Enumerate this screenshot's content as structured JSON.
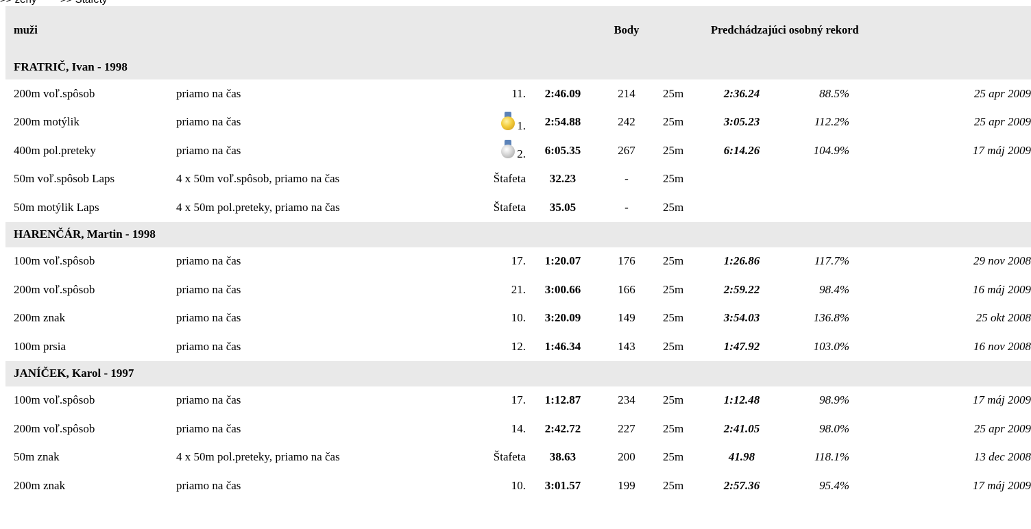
{
  "nav": {
    "link_women": ">> ženy",
    "link_relays": ">> Štafety"
  },
  "table": {
    "header": {
      "category": "muži",
      "points": "Body",
      "previous_pb": "Predchádzajúci osobný rekord"
    },
    "swimmers": [
      {
        "name": "FRATRIČ, Ivan - 1998",
        "results": [
          {
            "event": "200m voľ.spôsob",
            "heat": "priamo na čas",
            "place": "11.",
            "medal": "",
            "time": "2:46.09",
            "points": "214",
            "pool": "25m",
            "pb": "2:36.24",
            "pct": "88.5%",
            "date": "25 apr 2009"
          },
          {
            "event": "200m motýlik",
            "heat": "priamo na čas",
            "place": "1.",
            "medal": "gold-medal-icon",
            "time": "2:54.88",
            "points": "242",
            "pool": "25m",
            "pb": "3:05.23",
            "pct": "112.2%",
            "date": "25 apr 2009"
          },
          {
            "event": "400m pol.preteky",
            "heat": "priamo na čas",
            "place": "2.",
            "medal": "silver-medal-icon",
            "time": "6:05.35",
            "points": "267",
            "pool": "25m",
            "pb": "6:14.26",
            "pct": "104.9%",
            "date": "17 máj 2009"
          },
          {
            "event": "50m voľ.spôsob Laps",
            "heat": "4 x 50m voľ.spôsob, priamo na čas",
            "place": "Štafeta",
            "medal": "",
            "time": "32.23",
            "points": "-",
            "pool": "25m",
            "pb": "",
            "pct": "",
            "date": ""
          },
          {
            "event": "50m motýlik Laps",
            "heat": "4 x 50m pol.preteky, priamo na čas",
            "place": "Štafeta",
            "medal": "",
            "time": "35.05",
            "points": "-",
            "pool": "25m",
            "pb": "",
            "pct": "",
            "date": ""
          }
        ]
      },
      {
        "name": "HARENČÁR, Martin - 1998",
        "results": [
          {
            "event": "100m voľ.spôsob",
            "heat": "priamo na čas",
            "place": "17.",
            "medal": "",
            "time": "1:20.07",
            "points": "176",
            "pool": "25m",
            "pb": "1:26.86",
            "pct": "117.7%",
            "date": "29 nov 2008"
          },
          {
            "event": "200m voľ.spôsob",
            "heat": "priamo na čas",
            "place": "21.",
            "medal": "",
            "time": "3:00.66",
            "points": "166",
            "pool": "25m",
            "pb": "2:59.22",
            "pct": "98.4%",
            "date": "16 máj 2009"
          },
          {
            "event": "200m znak",
            "heat": "priamo na čas",
            "place": "10.",
            "medal": "",
            "time": "3:20.09",
            "points": "149",
            "pool": "25m",
            "pb": "3:54.03",
            "pct": "136.8%",
            "date": "25 okt 2008"
          },
          {
            "event": "100m prsia",
            "heat": "priamo na čas",
            "place": "12.",
            "medal": "",
            "time": "1:46.34",
            "points": "143",
            "pool": "25m",
            "pb": "1:47.92",
            "pct": "103.0%",
            "date": "16 nov 2008"
          }
        ]
      },
      {
        "name": "JANÍČEK, Karol - 1997",
        "results": [
          {
            "event": "100m voľ.spôsob",
            "heat": "priamo na čas",
            "place": "17.",
            "medal": "",
            "time": "1:12.87",
            "points": "234",
            "pool": "25m",
            "pb": "1:12.48",
            "pct": "98.9%",
            "date": "17 máj 2009"
          },
          {
            "event": "200m voľ.spôsob",
            "heat": "priamo na čas",
            "place": "14.",
            "medal": "",
            "time": "2:42.72",
            "points": "227",
            "pool": "25m",
            "pb": "2:41.05",
            "pct": "98.0%",
            "date": "25 apr 2009"
          },
          {
            "event": "50m znak",
            "heat": "4 x 50m pol.preteky, priamo na čas",
            "place": "Štafeta",
            "medal": "",
            "time": "38.63",
            "points": "200",
            "pool": "25m",
            "pb": "41.98",
            "pct": "118.1%",
            "date": "13 dec 2008"
          },
          {
            "event": "200m znak",
            "heat": "priamo na čas",
            "place": "10.",
            "medal": "",
            "time": "3:01.57",
            "points": "199",
            "pool": "25m",
            "pb": "2:57.36",
            "pct": "95.4%",
            "date": "17 máj 2009"
          }
        ]
      }
    ]
  }
}
